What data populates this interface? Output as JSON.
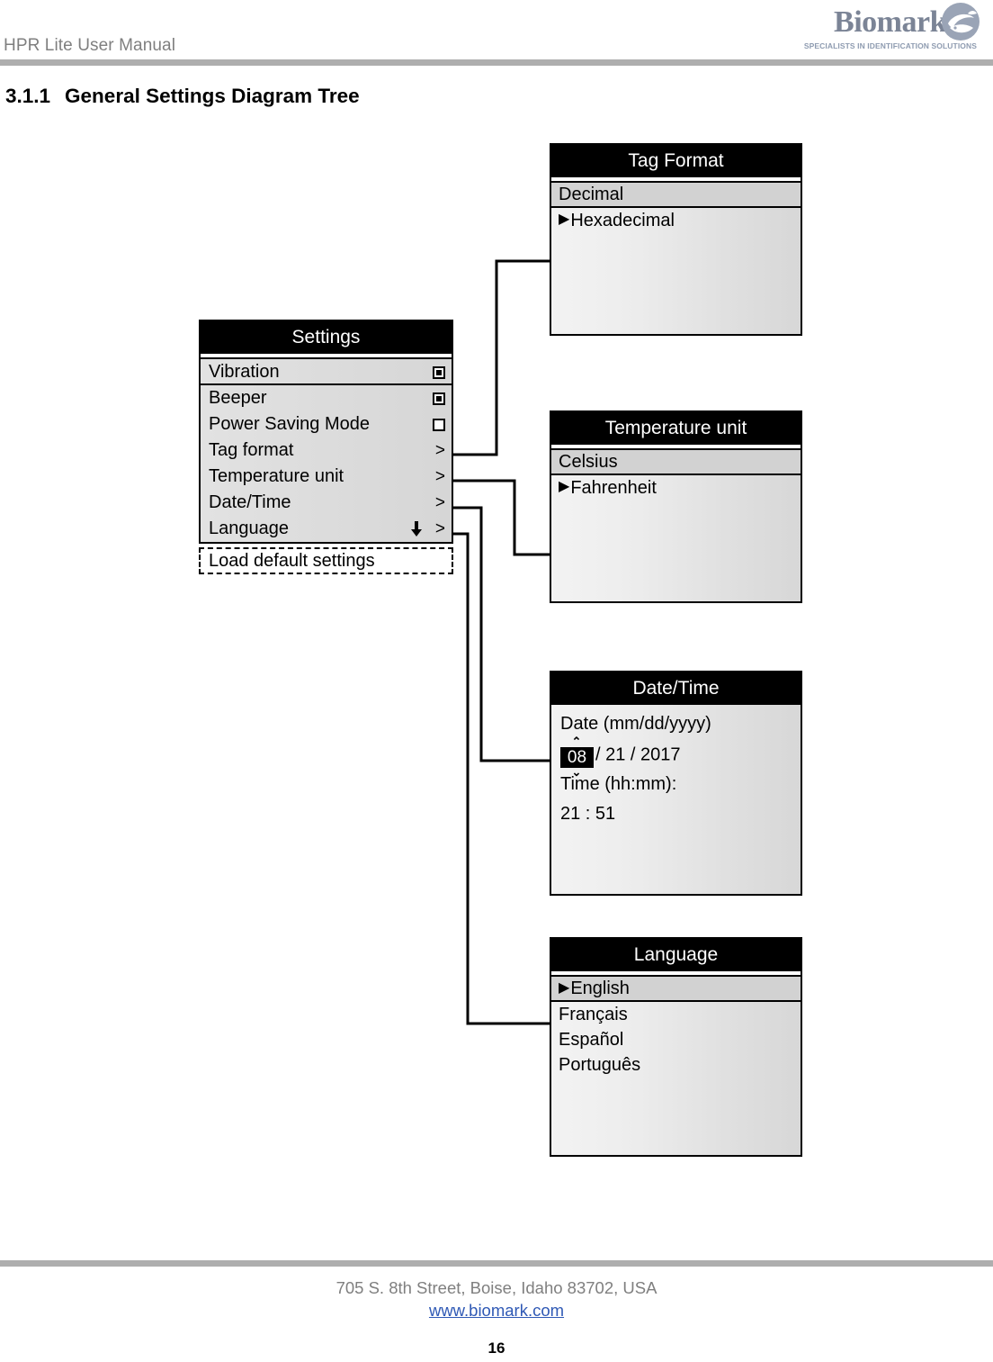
{
  "header": {
    "manual_title": "HPR Lite User Manual",
    "brand_name": "Biomark",
    "brand_tagline": "SPECIALISTS IN IDENTIFICATION SOLUTIONS"
  },
  "section": {
    "number": "3.1.1",
    "title": "General Settings Diagram Tree"
  },
  "settings_panel": {
    "title": "Settings",
    "rows": [
      {
        "label": "Vibration",
        "control": "checkbox",
        "checked": true,
        "chevron": ""
      },
      {
        "label": "Beeper",
        "control": "checkbox",
        "checked": true,
        "chevron": ""
      },
      {
        "label": "Power Saving Mode",
        "control": "checkbox",
        "checked": false,
        "chevron": ""
      },
      {
        "label": "Tag format",
        "control": "chevron",
        "checked": false,
        "chevron": ">"
      },
      {
        "label": "Temperature unit",
        "control": "chevron",
        "checked": false,
        "chevron": ">"
      },
      {
        "label": "Date/Time",
        "control": "chevron",
        "checked": false,
        "chevron": ">"
      },
      {
        "label": "Language",
        "control": "chevron",
        "checked": false,
        "chevron": ">",
        "scroll_arrow": "↓"
      }
    ],
    "footer_action": "Load default settings"
  },
  "tag_format_panel": {
    "title": "Tag Format",
    "options": [
      {
        "label": "Decimal",
        "selected": true,
        "marker": ""
      },
      {
        "label": "Hexadecimal",
        "selected": false,
        "marker": "▶"
      }
    ]
  },
  "temperature_unit_panel": {
    "title": "Temperature unit",
    "options": [
      {
        "label": "Celsius",
        "selected": true,
        "marker": ""
      },
      {
        "label": "Fahrenheit",
        "selected": false,
        "marker": "▶"
      }
    ]
  },
  "date_time_panel": {
    "title": "Date/Time",
    "date_label": "Date (mm/dd/yyyy)",
    "date_month": "08",
    "date_rest": "/ 21 / 2017",
    "caret_up": "⌃",
    "caret_down": "⌄",
    "time_label": "Time (hh:mm):",
    "time_value": "21 : 51"
  },
  "language_panel": {
    "title": "Language",
    "options": [
      {
        "label": "English",
        "selected": true,
        "marker": "▶"
      },
      {
        "label": "Français",
        "selected": false,
        "marker": ""
      },
      {
        "label": "Español",
        "selected": false,
        "marker": ""
      },
      {
        "label": "Português",
        "selected": false,
        "marker": ""
      }
    ]
  },
  "footer": {
    "address": "705 S. 8th Street, Boise, Idaho 83702, USA",
    "website": "www.biomark.com",
    "page_number": "16"
  },
  "colors": {
    "rule_gray": "#aeaeae",
    "header_text": "#7f7f7f",
    "brand_blue_gray": "#7b8496",
    "link_blue": "#2f59b5",
    "panel_title_bg": "#000000"
  }
}
